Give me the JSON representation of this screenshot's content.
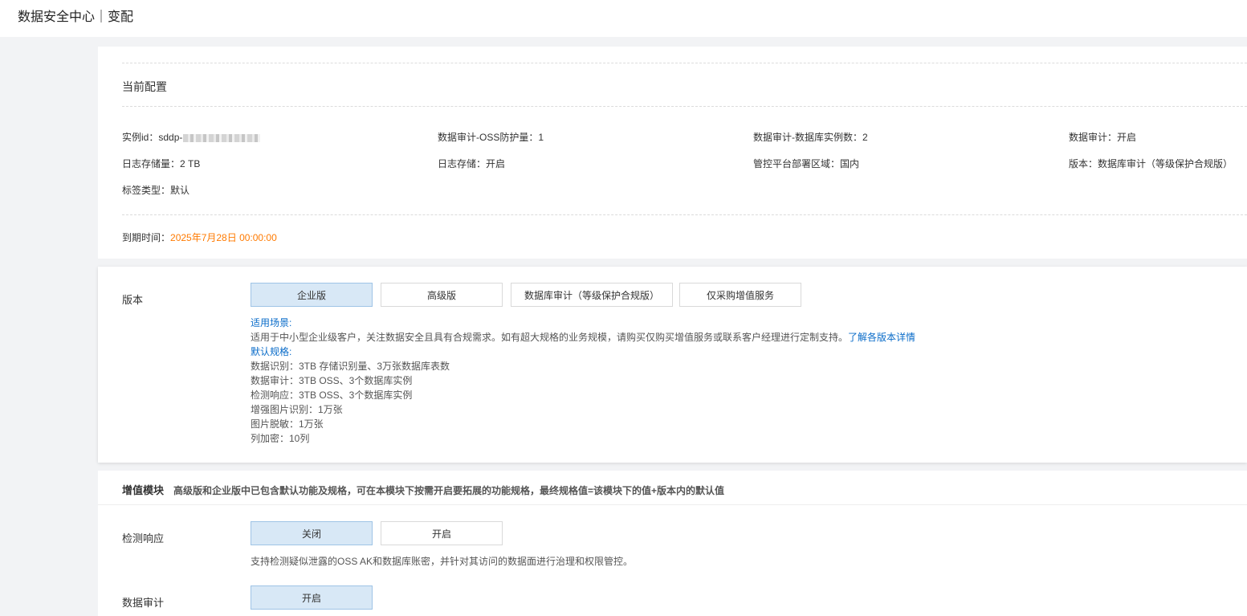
{
  "header": {
    "title": "数据安全中心｜变配"
  },
  "current_config": {
    "title": "当前配置",
    "instance_id_label": "实例id：sddp-",
    "info": [
      "数据审计-OSS防护量：1",
      "数据审计-数据库实例数：2",
      "数据审计：开启",
      "日志存储量：2 TB",
      "日志存储：开启",
      "管控平台部署区域：国内",
      "版本：数据库审计（等级保护合规版）",
      "标签类型：默认"
    ],
    "expire_label": "到期时间：",
    "expire_value": "2025年7月28日 00:00:00"
  },
  "version": {
    "label": "版本",
    "options": [
      "企业版",
      "高级版",
      "数据库审计（等级保护合规版）",
      "仅采购增值服务"
    ],
    "selected": "企业版",
    "scenario_title": "适用场景:",
    "scenario_text": "适用于中小型企业级客户，关注数据安全且具有合规需求。如有超大规格的业务规模，请购买仅购买增值服务或联系客户经理进行定制支持。",
    "scenario_link": "了解各版本详情",
    "spec_title": "默认规格:",
    "specs": [
      "数据识别：3TB 存储识别量、3万张数据库表数",
      "数据审计：3TB OSS、3个数据库实例",
      "检测响应：3TB OSS、3个数据库实例",
      "增强图片识别：1万张",
      "图片脱敏：1万张",
      "列加密：10列"
    ]
  },
  "addons": {
    "title": "增值模块",
    "subtitle": "高级版和企业版中已包含默认功能及规格，可在本模块下按需开启要拓展的功能规格，最终规格值=该模块下的值+版本内的默认值",
    "detection": {
      "label": "检测响应",
      "options": [
        "关闭",
        "开启"
      ],
      "selected": "关闭",
      "desc": "支持检测疑似泄露的OSS AK和数据库账密，并针对其访问的数据面进行治理和权限管控。"
    },
    "audit": {
      "label": "数据审计",
      "options": [
        "开启"
      ],
      "selected": "开启"
    }
  }
}
